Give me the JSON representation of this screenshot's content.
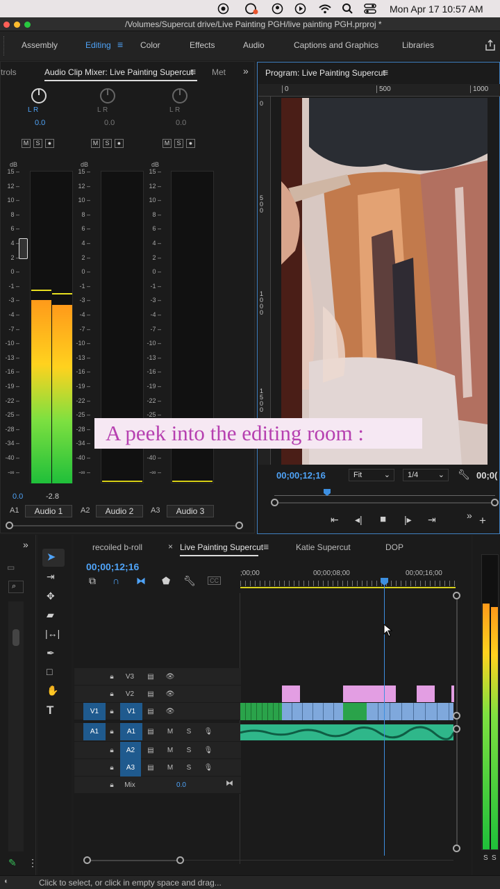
{
  "menubar": {
    "datetime": "Mon Apr 17  10:57 AM"
  },
  "window": {
    "title": "/Volumes/Supercut drive/Live Painting PGH/live painting PGH.prproj *"
  },
  "workspaces": [
    {
      "label": "Assembly"
    },
    {
      "label": "Editing",
      "active": true
    },
    {
      "label": "Color"
    },
    {
      "label": "Effects"
    },
    {
      "label": "Audio"
    },
    {
      "label": "Captions and Graphics"
    },
    {
      "label": "Libraries"
    }
  ],
  "mixer": {
    "tab_left": "trols",
    "tab_active": "Audio Clip Mixer: Live Painting Supercut",
    "tab_right": "Met",
    "channels": [
      {
        "track": "A1",
        "name": "Audio 1",
        "pan": "0.0",
        "level_left": "0.0",
        "level_right": "-2.8"
      },
      {
        "track": "A2",
        "name": "Audio 2",
        "pan": "0.0"
      },
      {
        "track": "A3",
        "name": "Audio 3",
        "pan": "0.0"
      }
    ],
    "db_label": "dB",
    "scale": [
      "15",
      "12",
      "10",
      "8",
      "6",
      "4",
      "2",
      "0",
      "-1",
      "-3",
      "-4",
      "-7",
      "-10",
      "-13",
      "-16",
      "-19",
      "-22",
      "-25",
      "-28",
      "-34",
      "-40",
      "-∞"
    ],
    "lr": "L  R",
    "m": "M",
    "s": "S"
  },
  "program": {
    "title": "Program: Live Painting Supercut",
    "timecode": "00;00;12;16",
    "fit": "Fit",
    "resolution": "1/4",
    "timecode_right": "00;0(",
    "ruler_h": [
      "0",
      "500",
      "1000"
    ],
    "ruler_v": [
      "0",
      "500",
      "1000",
      "1500"
    ]
  },
  "caption": "A peek into the editing room :",
  "timeline": {
    "tabs": [
      {
        "label": "recoiled b-roll"
      },
      {
        "label": "Live Painting Supercut",
        "active": true
      },
      {
        "label": "Katie Supercut"
      },
      {
        "label": "DOP"
      }
    ],
    "timecode": "00;00;12;16",
    "ruler": [
      ";00;00",
      "00;00;08;00",
      "00;00;16;00"
    ],
    "tracks": [
      {
        "src": "",
        "id": "V3"
      },
      {
        "src": "",
        "id": "V2"
      },
      {
        "src": "V1",
        "id": "V1"
      },
      {
        "src": "A1",
        "id": "A1"
      },
      {
        "src": "",
        "id": "A2"
      },
      {
        "src": "",
        "id": "A3"
      }
    ],
    "mix_label": "Mix",
    "mix_value": "0.0",
    "m": "M",
    "s": "S"
  },
  "status": {
    "text": "Click to select, or click in empty space and drag..."
  },
  "colors": {
    "accent": "#4fa3f7",
    "video_clip": "#7fa8dc",
    "graphic_clip": "#e39ee3",
    "audio_clip": "#2fb78a",
    "caption_text": "#b640b0"
  }
}
